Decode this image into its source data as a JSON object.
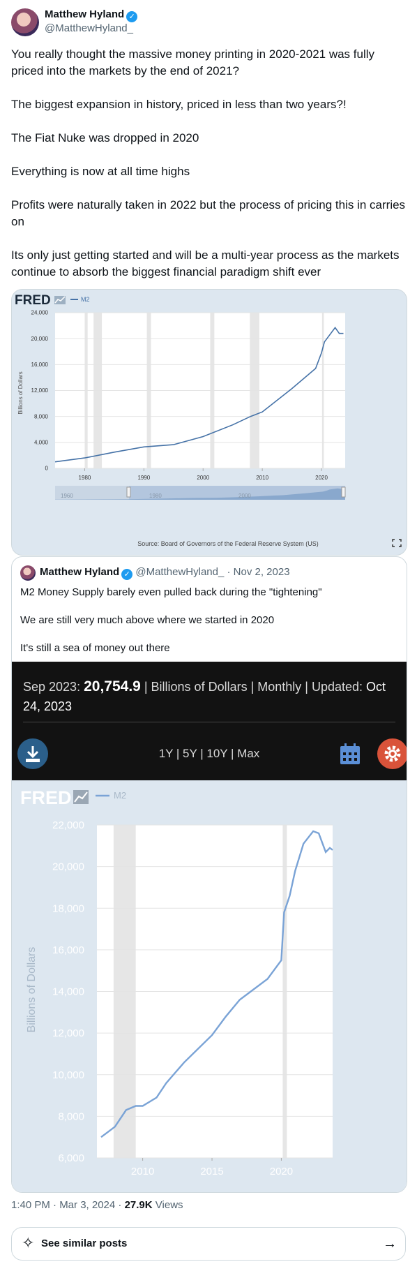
{
  "author": {
    "name": "Matthew Hyland",
    "handle": "@MatthewHyland_"
  },
  "tweet": {
    "paragraphs": [
      "You really thought the massive money printing in 2020-2021 was fully priced into the markets by the end of 2021?",
      "The biggest expansion in history, priced in less than two years?!",
      "The Fiat Nuke was dropped in 2020",
      "Everything is now at all time highs",
      "Profits were naturally taken in 2022 but the process of pricing this in carries on",
      "Its only just getting started and will be a multi-year process as the markets continue to absorb the biggest financial paradigm shift ever"
    ]
  },
  "card1": {
    "logo": "FRED",
    "legend": "M2",
    "ylabel": "Billions of Dollars",
    "yticks": [
      "24,000",
      "20,000",
      "16,000",
      "12,000",
      "8,000",
      "4,000",
      "0"
    ],
    "xticks": [
      "1980",
      "1990",
      "2000",
      "2010",
      "2020"
    ],
    "nav_ticks": [
      "1960",
      "1980",
      "2000"
    ],
    "source": "Source: Board of Governors of the Federal Reserve System (US)"
  },
  "quote": {
    "name": "Matthew Hyland",
    "handle": "@MatthewHyland_",
    "date": "· Nov 2, 2023",
    "paragraphs": [
      "M2 Money Supply barely even pulled back during the \"tightening\"",
      "We are still very much above where we started in 2020",
      "It's still a sea of money out there"
    ],
    "stat": {
      "period": "Sep 2023:",
      "value": "20,754.9",
      "mid": "| Billions of Dollars | Monthly | Updated:",
      "updated": "Oct 24, 2023"
    },
    "ranges": "1Y | 5Y | 10Y | Max"
  },
  "chart_data": [
    {
      "type": "line",
      "title": "",
      "series": [
        {
          "name": "M2",
          "x": [
            1975,
            1980,
            1985,
            1990,
            1995,
            2000,
            2005,
            2008,
            2010,
            2015,
            2019,
            2020,
            2020.5,
            2022.3,
            2023,
            2023.7
          ],
          "y": [
            1000,
            1600,
            2500,
            3300,
            3650,
            4900,
            6700,
            8000,
            8700,
            12300,
            15400,
            17800,
            19500,
            21700,
            20800,
            20800
          ]
        }
      ],
      "xlabel": "",
      "ylabel": "Billions of Dollars",
      "xlim": [
        1975,
        2024
      ],
      "ylim": [
        0,
        24000
      ],
      "recessions": [
        [
          1980,
          1980.5
        ],
        [
          1981.5,
          1982.9
        ],
        [
          1990.5,
          1991.2
        ],
        [
          2001.2,
          2001.9
        ],
        [
          2007.9,
          2009.5
        ],
        [
          2020.1,
          2020.4
        ]
      ],
      "color": "#4572a7"
    },
    {
      "type": "line",
      "title": "",
      "series": [
        {
          "name": "M2",
          "x": [
            2007,
            2008,
            2008.8,
            2009.5,
            2010,
            2011,
            2011.7,
            2013,
            2015,
            2016,
            2017,
            2018,
            2019,
            2020,
            2020.2,
            2020.6,
            2021,
            2021.6,
            2022.3,
            2022.7,
            2023.2,
            2023.5,
            2023.7
          ],
          "y": [
            7000,
            7500,
            8300,
            8500,
            8500,
            8900,
            9600,
            10600,
            11900,
            12800,
            13600,
            14100,
            14600,
            15500,
            17800,
            18600,
            19800,
            21100,
            21700,
            21600,
            20700,
            20900,
            20800
          ]
        }
      ],
      "xlabel": "",
      "ylabel": "Billions of Dollars",
      "xticks": [
        "2010",
        "2015",
        "2020"
      ],
      "yticks": [
        "22,000",
        "20,000",
        "18,000",
        "16,000",
        "14,000",
        "12,000",
        "10,000",
        "8,000",
        "6,000"
      ],
      "xlim": [
        2006.7,
        2023.7
      ],
      "ylim": [
        6000,
        22000
      ],
      "recessions": [
        [
          2007.9,
          2009.5
        ],
        [
          2020.1,
          2020.4
        ]
      ],
      "color": "#7aa3d6"
    }
  ],
  "footer": {
    "time": "1:40 PM · Mar 3, 2024 ·",
    "views_count": "27.9K",
    "views_label": "Views",
    "similar": "See similar posts"
  }
}
